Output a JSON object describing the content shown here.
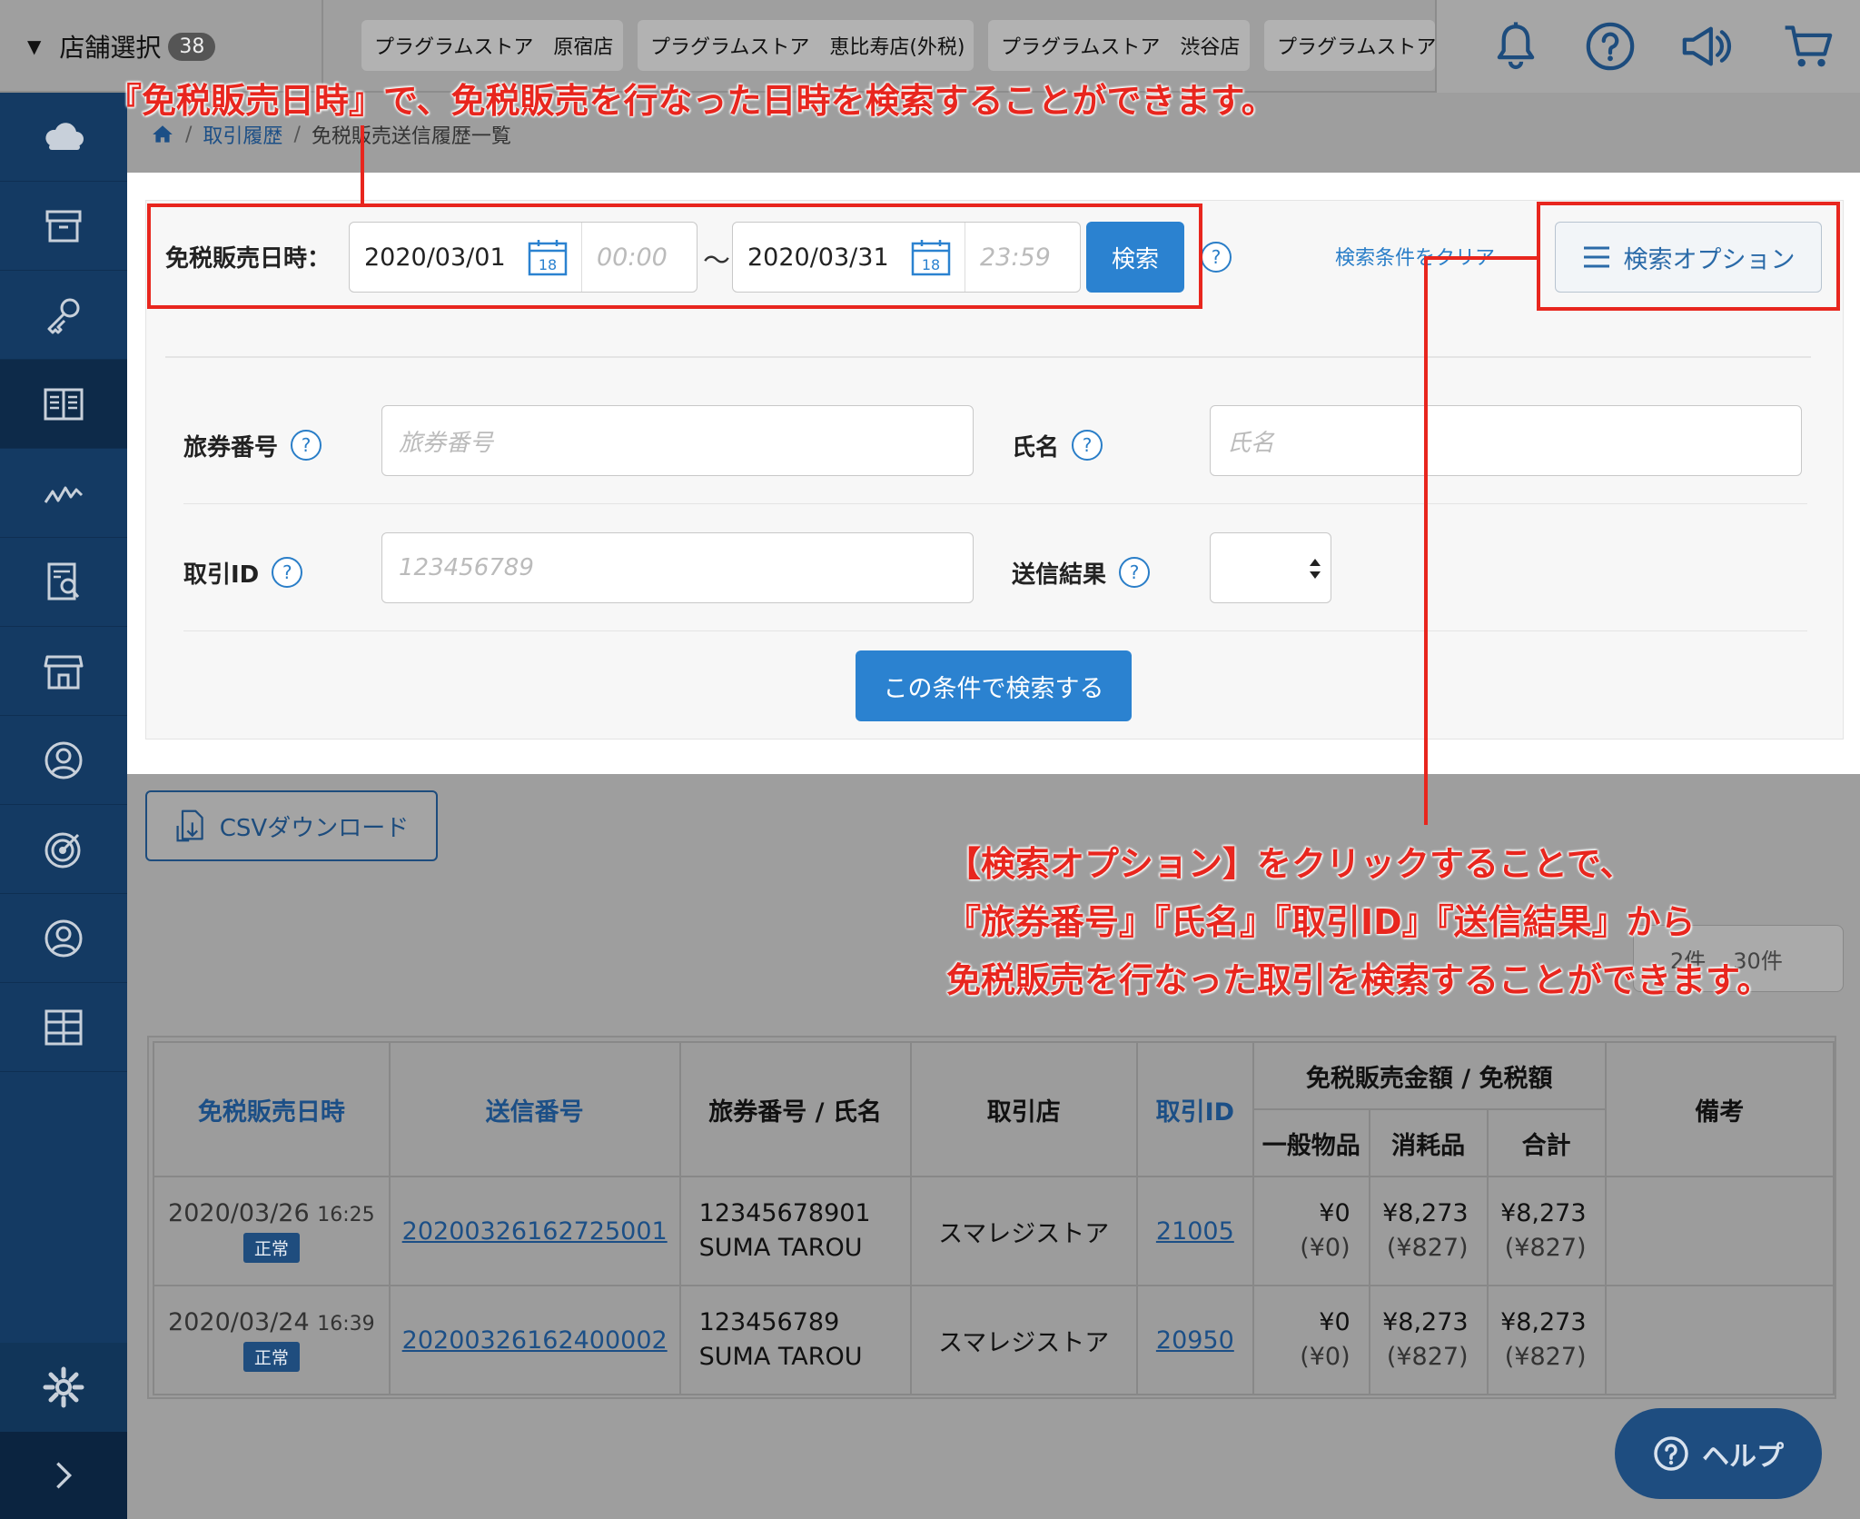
{
  "header": {
    "store_select_label": "店舗選択",
    "store_count": "38",
    "store_tabs": [
      "プラグラムストア　原宿店",
      "プラグラムストア　恵比寿店(外税)",
      "プラグラムストア　渋谷店",
      "プラグラムストア"
    ]
  },
  "icons": {
    "top": [
      "bell-icon",
      "help-icon",
      "megaphone-icon",
      "cart-icon"
    ],
    "sidebar": [
      "cloud-icon",
      "archive-icon",
      "key-icon",
      "book-icon",
      "chart-icon",
      "report-icon",
      "store-icon",
      "user-circle-icon",
      "target-icon",
      "user-icon",
      "grid-icon",
      "gear-icon",
      "chevron-right-icon"
    ]
  },
  "breadcrumb": {
    "home": "home-icon",
    "items": [
      "取引履歴",
      "免税販売送信履歴一覧"
    ]
  },
  "search": {
    "date_label": "免税販売日時：",
    "date_from": "2020/03/01",
    "time_from": "00:00",
    "tilde": "〜",
    "date_to": "2020/03/31",
    "time_to": "23:59",
    "calendar_day": "18",
    "search_button": "検索",
    "clear_link": "検索条件をクリア",
    "options_button": "検索オプション",
    "passport_label": "旅券番号",
    "passport_placeholder": "旅券番号",
    "name_label": "氏名",
    "name_placeholder": "氏名",
    "txid_label": "取引ID",
    "txid_placeholder": "123456789",
    "result_label": "送信結果",
    "result_value": "",
    "submit_button": "この条件で検索する"
  },
  "actions": {
    "csv_button": "CSVダウンロード",
    "count_text": "2件",
    "per_page": "30件"
  },
  "table": {
    "headers": {
      "datetime": "免税販売日時",
      "send_no": "送信番号",
      "passport_name": "旅券番号 / 氏名",
      "store": "取引店",
      "txid": "取引ID",
      "amount_group": "免税販売金額 / 免税額",
      "general": "一般物品",
      "consumable": "消耗品",
      "total": "合計",
      "note": "備考"
    },
    "rows": [
      {
        "date": "2020/03/26",
        "time": "16:25",
        "status": "正常",
        "send_no": "20200326162725001",
        "passport": "12345678901",
        "name": "SUMA TAROU",
        "store": "スマレジストア",
        "txid": "21005",
        "general": "¥0",
        "general_tax": "(¥0)",
        "consumable": "¥8,273",
        "consumable_tax": "(¥827)",
        "total": "¥8,273",
        "total_tax": "(¥827)",
        "note": ""
      },
      {
        "date": "2020/03/24",
        "time": "16:39",
        "status": "正常",
        "send_no": "20200326162400002",
        "passport": "123456789",
        "name": "SUMA TAROU",
        "store": "スマレジストア",
        "txid": "20950",
        "general": "¥0",
        "general_tax": "(¥0)",
        "consumable": "¥8,273",
        "consumable_tax": "(¥827)",
        "total": "¥8,273",
        "total_tax": "(¥827)",
        "note": ""
      }
    ]
  },
  "help_button": "ヘルプ",
  "annotations": {
    "top": "『免税販売日時』で、免税販売を行なった日時を検索することができます。",
    "right_line1": "【検索オプション】をクリックすることで、",
    "right_line2": "『旅券番号』『氏名』『取引ID』『送信結果』から",
    "right_line3": "免税販売を行なった取引を検索することができます。"
  },
  "colors": {
    "annotation": "#e8261e",
    "sidebar": "#143a63",
    "primary_button": "#2b82d0",
    "link": "#1c4f86"
  }
}
